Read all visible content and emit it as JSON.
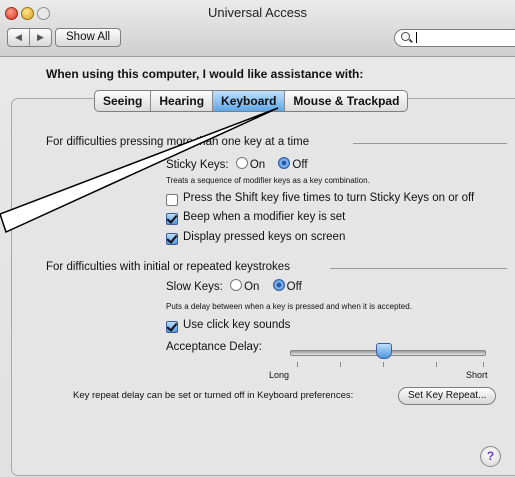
{
  "window": {
    "title": "Universal Access",
    "show_all": "Show All",
    "back_icon": "back-arrow-icon",
    "forward_icon": "forward-arrow-icon",
    "search_icon": "search-icon"
  },
  "heading": "When using this computer, I would like assistance with:",
  "tabs": [
    {
      "label": "Seeing",
      "selected": false
    },
    {
      "label": "Hearing",
      "selected": false
    },
    {
      "label": "Keyboard",
      "selected": true
    },
    {
      "label": "Mouse & Trackpad",
      "selected": false
    }
  ],
  "section1": {
    "title": "For difficulties pressing more than one key at a time",
    "sticky_label": "Sticky Keys:",
    "on": "On",
    "off": "Off",
    "sticky_state": "Off",
    "desc": "Treats a sequence of modifier keys as a key combination.",
    "opt1": "Press the Shift key five times to turn Sticky Keys on or off",
    "opt1_checked": false,
    "opt2": "Beep when a modifier key is set",
    "opt2_checked": true,
    "opt3": "Display pressed keys on screen",
    "opt3_checked": true
  },
  "section2": {
    "title": "For difficulties with initial or repeated keystrokes",
    "slow_label": "Slow Keys:",
    "on": "On",
    "off": "Off",
    "slow_state": "Off",
    "desc": "Puts a delay between when a key is pressed and when it is accepted.",
    "click_sounds": "Use click key sounds",
    "click_sounds_checked": true,
    "delay_label": "Acceptance Delay:",
    "delay_min_label": "Long",
    "delay_max_label": "Short",
    "delay_value_fraction": 0.45
  },
  "repeat_note": "Key repeat delay can be set or turned off in Keyboard preferences:",
  "set_key_repeat": "Set Key Repeat...",
  "help_label": "?",
  "colors": {
    "accent": "#5fa7e8",
    "help": "#6a3ab4"
  }
}
